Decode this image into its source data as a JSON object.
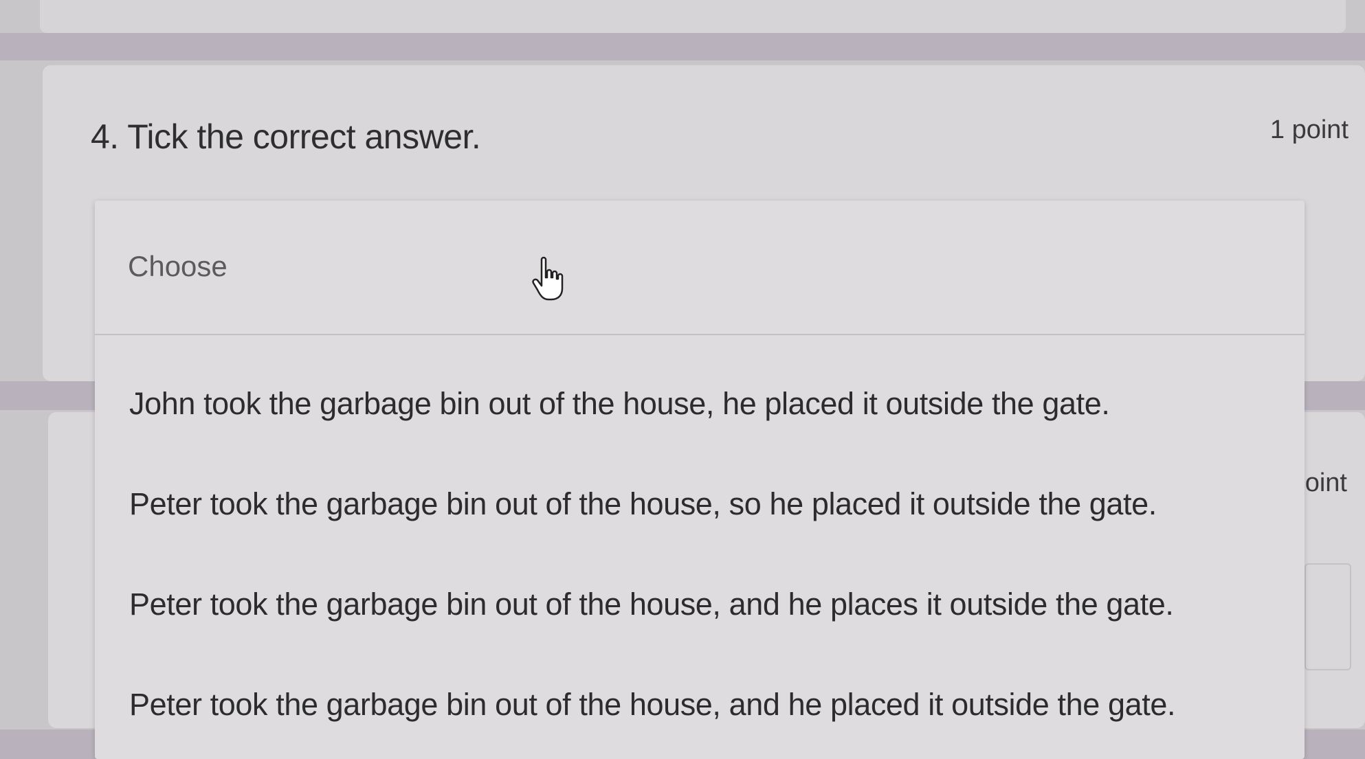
{
  "question": {
    "title": "4. Tick the correct answer.",
    "points": "1 point"
  },
  "next_question": {
    "points_fragment": "oint"
  },
  "dropdown": {
    "placeholder": "Choose",
    "options": [
      "John took the garbage bin out of the house, he placed it outside the gate.",
      "Peter took the garbage bin out of the house, so he placed it outside the gate.",
      "Peter took the garbage bin out of the house, and he places it outside the gate.",
      "Peter took the garbage bin out of the house, and he placed it outside the gate."
    ]
  },
  "cursor": {
    "icon": "hand-pointer-icon"
  }
}
